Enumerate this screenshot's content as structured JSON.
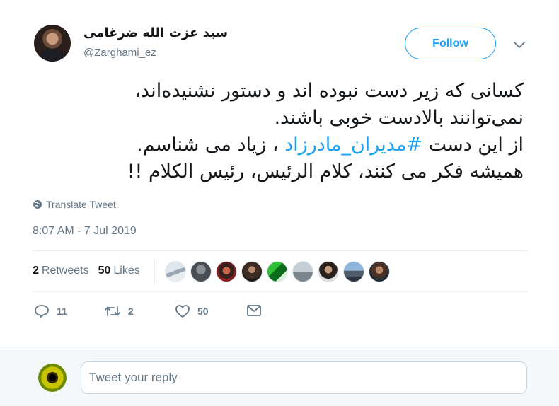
{
  "author": {
    "name": "سید عزت الله ضرغامی",
    "handle": "@Zarghami_ez"
  },
  "follow_label": "Follow",
  "tweet": {
    "line1": "کسانی که زیر دست نبوده اند و دستور نشنیده‌اند،",
    "line2": "نمی‌توانند بالادست خوبی باشند.",
    "line3_before": "از این دست ",
    "line3_hashtag": "#مدیران_مادرزاد",
    "line3_after": " ، زیاد می شناسم.",
    "line4": "همیشه فکر می کنند، کلام الرئیس، رئیس الکلام !!"
  },
  "translate_label": "Translate Tweet",
  "timestamp": "8:07 AM - 7 Jul 2019",
  "stats": {
    "retweets_count": "2",
    "retweets_label": "Retweets",
    "likes_count": "50",
    "likes_label": "Likes"
  },
  "actions": {
    "replies": "11",
    "retweets": "2",
    "likes": "50"
  },
  "reply_placeholder": "Tweet your reply",
  "colors": {
    "accent": "#1da1f2",
    "muted": "#657786",
    "divider": "#e6ecf0"
  }
}
